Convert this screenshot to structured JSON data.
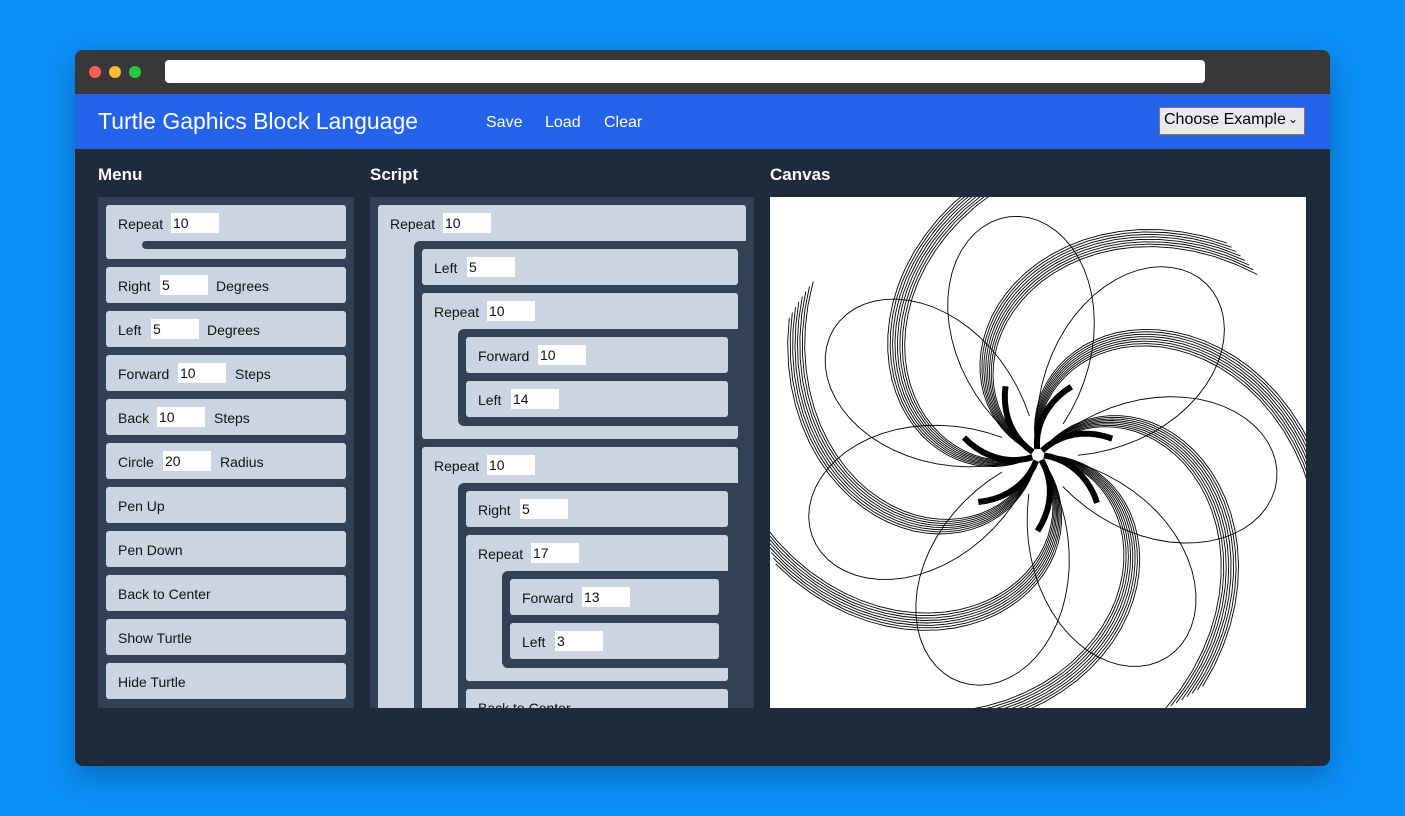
{
  "nav": {
    "brand": "Turtle Gaphics Block Language",
    "links": [
      "Save",
      "Load",
      "Clear"
    ],
    "example_select": "Choose Example"
  },
  "headings": {
    "menu": "Menu",
    "script": "Script",
    "canvas": "Canvas"
  },
  "menu": {
    "repeat": {
      "label": "Repeat",
      "value": "10"
    },
    "right": {
      "label": "Right",
      "value": "5",
      "unit": "Degrees"
    },
    "left": {
      "label": "Left",
      "value": "5",
      "unit": "Degrees"
    },
    "forward": {
      "label": "Forward",
      "value": "10",
      "unit": "Steps"
    },
    "back": {
      "label": "Back",
      "value": "10",
      "unit": "Steps"
    },
    "circle": {
      "label": "Circle",
      "value": "20",
      "unit": "Radius"
    },
    "pen_up": "Pen Up",
    "pen_down": "Pen Down",
    "back_center": "Back to Center",
    "show_turtle": "Show Turtle",
    "hide_turtle": "Hide Turtle"
  },
  "script": {
    "repeat_outer": {
      "label": "Repeat",
      "value": "10"
    },
    "left_a": {
      "label": "Left",
      "value": "5"
    },
    "repeat_a": {
      "label": "Repeat",
      "value": "10"
    },
    "forward_a": {
      "label": "Forward",
      "value": "10"
    },
    "left_b": {
      "label": "Left",
      "value": "14"
    },
    "repeat_b": {
      "label": "Repeat",
      "value": "10"
    },
    "right_a": {
      "label": "Right",
      "value": "5"
    },
    "repeat_c": {
      "label": "Repeat",
      "value": "17"
    },
    "forward_b": {
      "label": "Forward",
      "value": "13"
    },
    "left_c": {
      "label": "Left",
      "value": "3"
    },
    "back_center": "Back to Center"
  },
  "colors": {
    "navbar": "#2563eb",
    "app_bg": "#1f2a3c",
    "panel": "#334155",
    "block": "#cbd5e1",
    "page_bg": "#0a8ff6"
  }
}
